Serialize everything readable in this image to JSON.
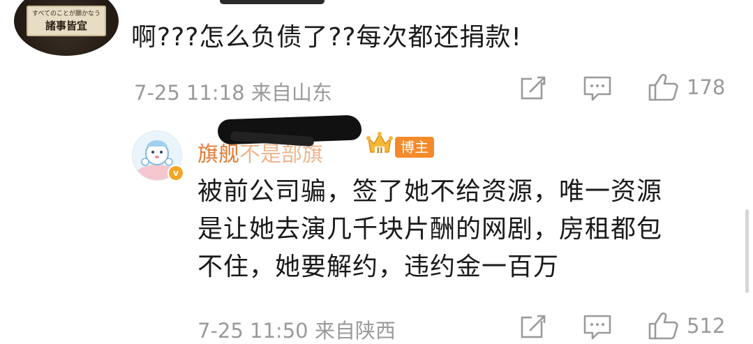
{
  "comments": [
    {
      "avatar_sign": {
        "line1": "すべてのことが願かなう",
        "line2": "諸事皆宜"
      },
      "text": "啊???怎么负债了??每次都还捐款!",
      "meta": "7-25 11:18 来自山东",
      "actions": {
        "likes": "178"
      }
    }
  ],
  "reply": {
    "username": "旗舰",
    "username_suffix": "不是部旗",
    "badge": "博主",
    "verify_badge": "v",
    "crown_level": "II",
    "lines": [
      "被前公司骗，签了她不给资源，唯一资源",
      "是让她去演几千块片酬的网剧，房租都包",
      "不住，她要解约，违约金一百万"
    ],
    "meta": "7-25 11:50 来自陕西",
    "actions": {
      "likes": "512"
    }
  },
  "colors": {
    "username": "#e07a32",
    "badge": "#f58a2a",
    "meta": "#9a9a9a"
  },
  "icons": {
    "share": "share-icon",
    "comment": "comment-icon",
    "like": "thumbs-up-icon"
  }
}
